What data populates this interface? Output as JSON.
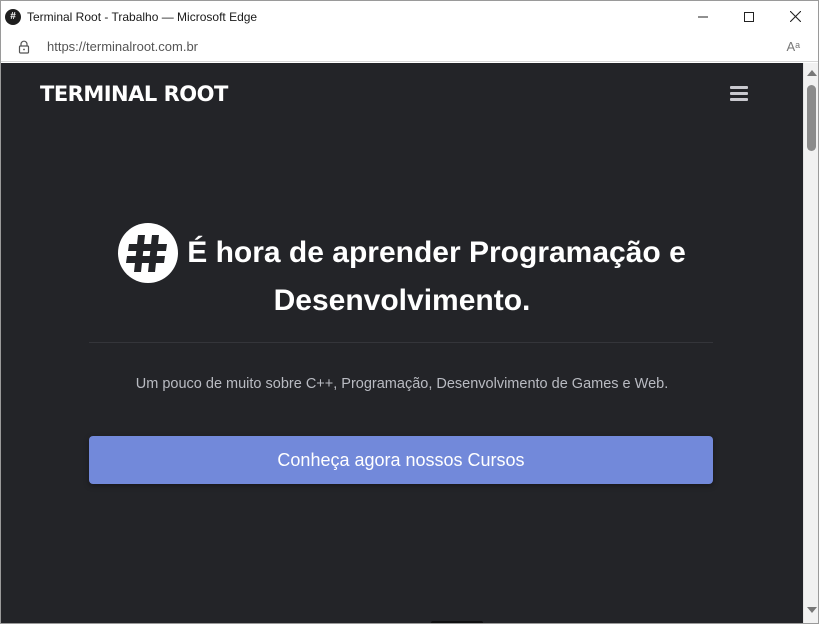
{
  "window": {
    "title": "Terminal Root - Trabalho — Microsoft Edge",
    "favicon": "#"
  },
  "addressbar": {
    "url": "https://terminalroot.com.br",
    "read_aloud": "Aᵃ"
  },
  "page": {
    "brand": "TERMINAL ROOT",
    "hero_line1": "É hora de aprender Programação e",
    "hero_line2": "Desenvolvimento.",
    "subtitle": "Um pouco de muito sobre C++, Programação, Desenvolvimento de Games e Web.",
    "cta_label": "Conheça agora nossos Cursos"
  },
  "colors": {
    "page_background": "#232428",
    "accent": "#7289da",
    "subtitle_text": "#b9bbc2"
  },
  "icons": {
    "lock": "lock-icon",
    "menu": "hamburger-menu-icon",
    "logo": "hash-logo-icon"
  }
}
